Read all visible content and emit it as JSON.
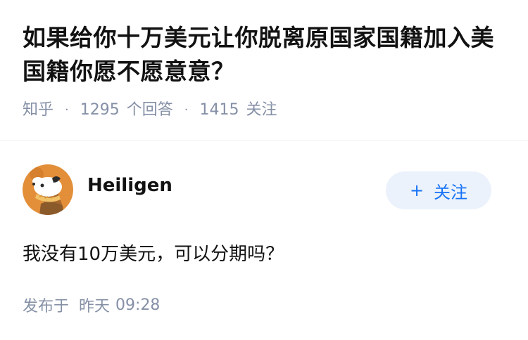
{
  "question": {
    "title": "如果给你十万美元让你脱离原国家国籍加入美国籍你愿不愿意意？",
    "source": "知乎",
    "separator": "·",
    "answers_count": "1295",
    "answers_label": "个回答",
    "followers_count": "1415",
    "followers_label": "关注"
  },
  "answer": {
    "author_name": "Heiligen",
    "follow_label": "关注",
    "follow_plus": "+",
    "content": "我没有10万美元，可以分期吗？",
    "published_label": "发布于",
    "published_day": "昨天",
    "published_time": "09:28"
  },
  "colors": {
    "title": "#121212",
    "meta": "#8590a6",
    "accent": "#1772f6",
    "follow_bg": "#ebf2fb",
    "avatar_bg": "#e38f3a"
  },
  "icons": {
    "avatar": "dog-avatar-icon"
  }
}
